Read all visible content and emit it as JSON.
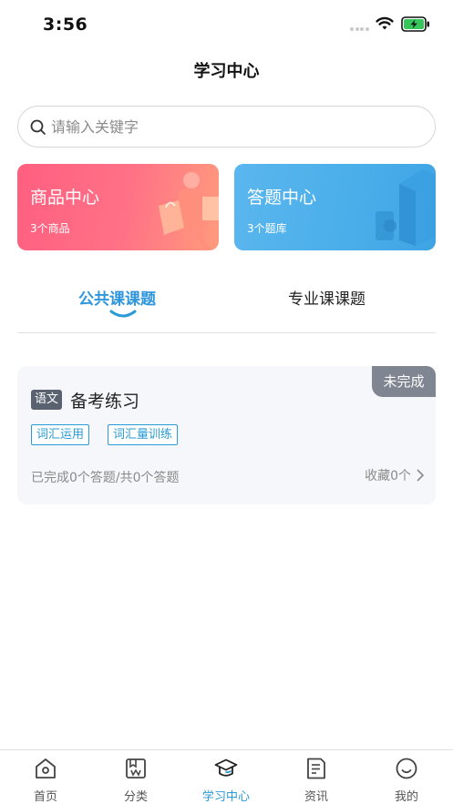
{
  "status_bar": {
    "time": "3:56"
  },
  "nav": {
    "title": "学习中心"
  },
  "search": {
    "placeholder": "请输入关键字"
  },
  "cards": {
    "goods": {
      "title": "商品中心",
      "subtitle": "3个商品"
    },
    "quiz": {
      "title": "答题中心",
      "subtitle": "3个题库"
    }
  },
  "tabs": [
    {
      "label": "公共课课题",
      "active": true
    },
    {
      "label": "专业课课题",
      "active": false
    }
  ],
  "exam": {
    "status": "未完成",
    "subject": "语文",
    "title": "备考练习",
    "keywords": [
      "词汇运用",
      "词汇量训练"
    ],
    "progress": "已完成0个答题/共0个答题",
    "favorites": "收藏0个"
  },
  "tabbar": [
    {
      "label": "首页",
      "icon": "home-icon"
    },
    {
      "label": "分类",
      "icon": "category-icon"
    },
    {
      "label": "学习中心",
      "icon": "graduation-cap-icon",
      "active": true
    },
    {
      "label": "资讯",
      "icon": "news-icon"
    },
    {
      "label": "我的",
      "icon": "smile-icon"
    }
  ],
  "colors": {
    "accent": "#2a9bd6",
    "goods_card": "#ff6b84",
    "quiz_card": "#4cb0ea",
    "badge": "#7f8591"
  }
}
